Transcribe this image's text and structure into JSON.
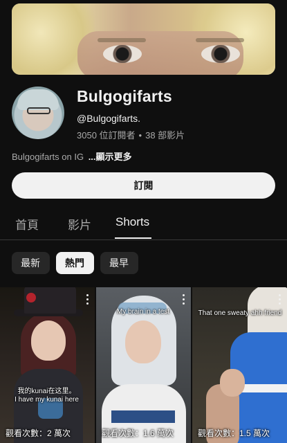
{
  "channel": {
    "name": "Bulgogifarts",
    "handle": "@Bulgogifarts.",
    "subscribers": "3050 位訂閱者",
    "separator": "•",
    "video_count": "38 部影片",
    "description": "Bulgogifarts on IG",
    "show_more": "...顯示更多",
    "subscribe_label": "訂閱"
  },
  "tabs": [
    {
      "label": "首頁",
      "active": false
    },
    {
      "label": "影片",
      "active": false
    },
    {
      "label": "Shorts",
      "active": true
    }
  ],
  "filters": [
    {
      "label": "最新",
      "selected": false
    },
    {
      "label": "熱門",
      "selected": true
    },
    {
      "label": "最早",
      "selected": false
    }
  ],
  "shorts": [
    {
      "caption_line1": "我的kunai在这里。",
      "caption_line2": "I have my kunai here",
      "views": "觀看次數：2 萬次"
    },
    {
      "caption": "My brain in a test",
      "views": "觀看次數：1.6 萬次"
    },
    {
      "caption": "That one sweaty ahh friend",
      "views": "觀看次數：1.5 萬次"
    }
  ],
  "icons": {
    "more": "vertical-ellipsis-icon"
  },
  "colors": {
    "background": "#0f0f0f",
    "text_primary": "#f1f1f1",
    "text_secondary": "#aaaaaa",
    "chip_bg": "#272727"
  }
}
